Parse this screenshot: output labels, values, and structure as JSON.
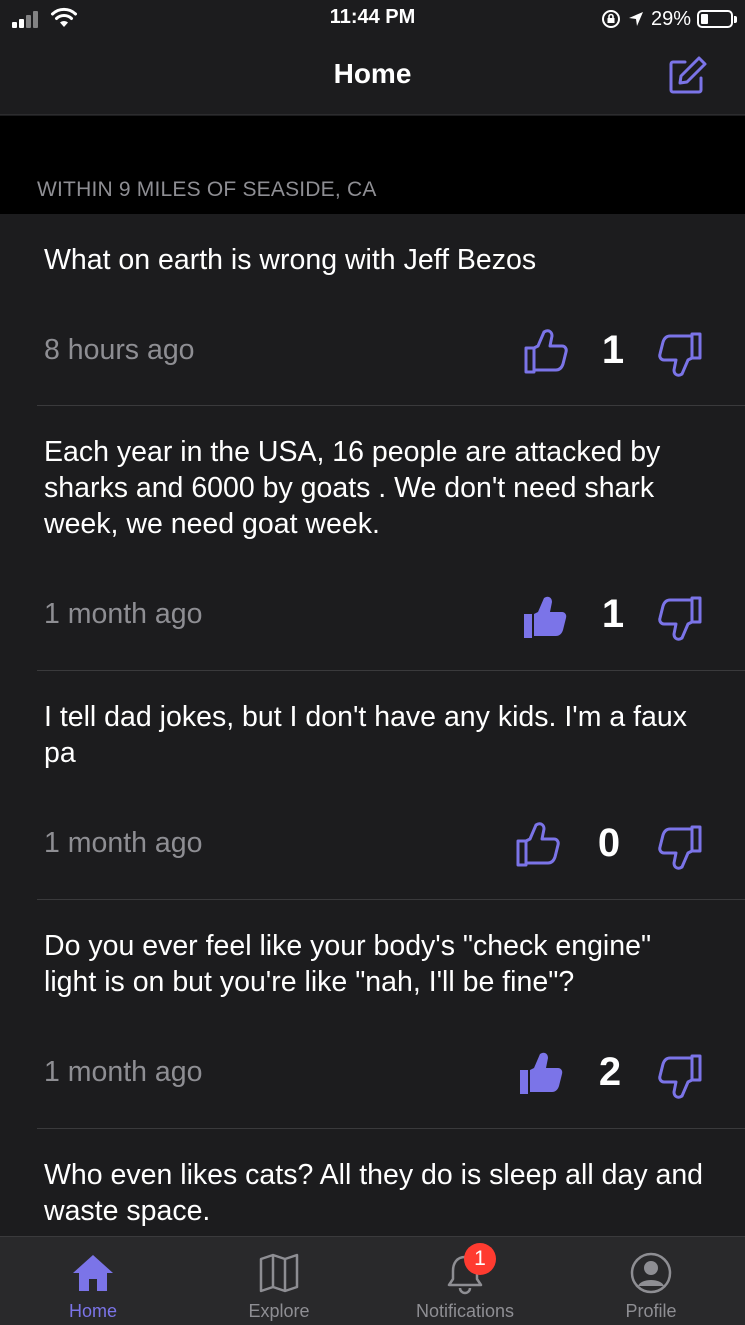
{
  "status_bar": {
    "time": "11:44 PM",
    "battery": "29%"
  },
  "nav": {
    "title": "Home",
    "compose_icon": "compose-icon"
  },
  "section": {
    "label": "WITHIN 9 MILES OF SEASIDE, CA"
  },
  "colors": {
    "accent": "#7b74e8",
    "background": "#1c1c1e",
    "header_band": "#000000",
    "muted_text": "#8e8e93",
    "badge": "#ff3b30"
  },
  "posts": [
    {
      "text": "What on earth is wrong with Jeff Bezos",
      "time": "8 hours ago",
      "score": "1",
      "upvoted": false
    },
    {
      "text": "Each year in the USA, 16 people are attacked by sharks and 6000 by goats . We don't need shark week, we need goat week.",
      "time": "1 month ago",
      "score": "1",
      "upvoted": true
    },
    {
      "text": "I tell dad jokes, but I don't have any kids. I'm a faux pa",
      "time": "1 month ago",
      "score": "0",
      "upvoted": false
    },
    {
      "text": "Do you ever feel like your body's \"check engine\" light is on but you're like \"nah, I'll be fine\"?",
      "time": "1 month ago",
      "score": "2",
      "upvoted": true
    },
    {
      "text": "Who even likes cats? All they do is sleep all day and waste space.",
      "time": "",
      "score": "",
      "upvoted": false
    }
  ],
  "tabs": [
    {
      "label": "Home",
      "icon": "home-icon",
      "active": true
    },
    {
      "label": "Explore",
      "icon": "map-icon",
      "active": false
    },
    {
      "label": "Notifications",
      "icon": "bell-icon",
      "active": false,
      "badge": "1"
    },
    {
      "label": "Profile",
      "icon": "profile-icon",
      "active": false
    }
  ]
}
